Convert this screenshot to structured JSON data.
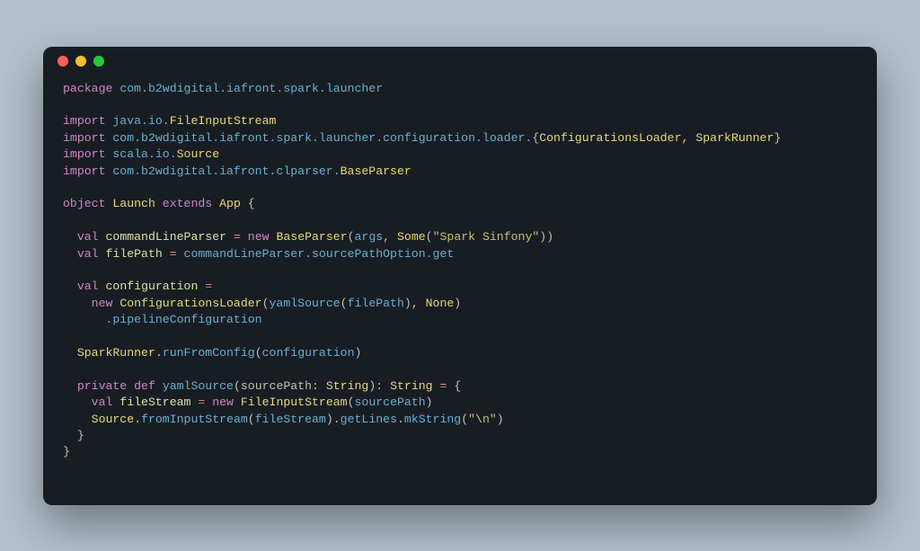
{
  "code": {
    "l1": {
      "kw": "package",
      "pkg": " com.b2wdigital.iafront.spark.launcher"
    },
    "l2": "",
    "l3": {
      "kw": "import",
      "pkg": " java.io.",
      "type": "FileInputStream"
    },
    "l4": {
      "kw": "import",
      "pkg": " com.b2wdigital.iafront.spark.launcher.configuration.loader.",
      "punc": "{",
      "types": "ConfigurationsLoader, SparkRunner",
      "punc2": "}"
    },
    "l5": {
      "kw": "import",
      "pkg": " scala.io.",
      "type": "Source"
    },
    "l6": {
      "kw": "import",
      "pkg": " com.b2wdigital.iafront.clparser.",
      "type": "BaseParser"
    },
    "l7": "",
    "l8": {
      "kw1": "object",
      "name": " Launch ",
      "kw2": "extends",
      "type": " App ",
      "punc": "{"
    },
    "l9": "",
    "l10": {
      "indent": "  ",
      "kw": "val",
      "var": " commandLineParser ",
      "op": "=",
      "kw2": " new ",
      "type": "BaseParser",
      "punc1": "(",
      "arg1": "args",
      "punc2": ", ",
      "some": "Some",
      "punc3": "(",
      "str": "\"Spark Sinfony\"",
      "punc4": "))"
    },
    "l11": {
      "indent": "  ",
      "kw": "val",
      "var": " filePath ",
      "op": "=",
      "rest": " commandLineParser.sourcePathOption.get"
    },
    "l12": "",
    "l13": {
      "indent": "  ",
      "kw": "val",
      "var": " configuration ",
      "op": "="
    },
    "l14": {
      "indent": "    ",
      "kw": "new ",
      "type": "ConfigurationsLoader",
      "punc1": "(",
      "fn": "yamlSource",
      "punc2": "(",
      "arg": "filePath",
      "punc3": "), ",
      "none": "None",
      "punc4": ")"
    },
    "l15": {
      "indent": "      ",
      "rest": ".pipelineConfiguration"
    },
    "l16": "",
    "l17": {
      "indent": "  ",
      "type": "SparkRunner",
      "punc1": ".",
      "fn": "runFromConfig",
      "punc2": "(",
      "arg": "configuration",
      "punc3": ")"
    },
    "l18": "",
    "l19": {
      "indent": "  ",
      "kw1": "private",
      "kw2": " def ",
      "fn": "yamlSource",
      "punc1": "(",
      "param": "sourcePath",
      "punc2": ": ",
      "ptype": "String",
      "punc3": "): ",
      "rtype": "String",
      "op": " = ",
      "punc4": "{"
    },
    "l20": {
      "indent": "    ",
      "kw": "val",
      "var": " fileStream ",
      "op": "=",
      "kw2": " new ",
      "type": "FileInputStream",
      "punc1": "(",
      "arg": "sourcePath",
      "punc2": ")"
    },
    "l21": {
      "indent": "    ",
      "type": "Source",
      "punc1": ".",
      "fn1": "fromInputStream",
      "punc2": "(",
      "arg": "fileStream",
      "punc3": ").",
      "fn2": "getLines",
      "punc4": ".",
      "fn3": "mkString",
      "punc5": "(",
      "str": "\"\\n\"",
      "punc6": ")"
    },
    "l22": {
      "indent": "  ",
      "punc": "}"
    },
    "l23": {
      "punc": "}"
    }
  }
}
